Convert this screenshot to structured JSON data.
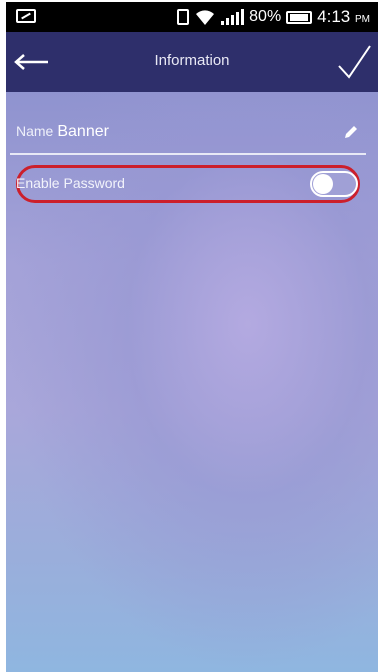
{
  "status_bar": {
    "battery_percent": "80%",
    "time": "4:13",
    "time_suffix": "PM"
  },
  "app_bar": {
    "title": "Information",
    "back_icon": "arrow-left-icon",
    "confirm_icon": "checkmark-icon"
  },
  "form": {
    "name_label": "Name",
    "name_value": "Banner",
    "edit_icon": "pencil-icon",
    "password_label": "Enable Password",
    "password_enabled": false
  },
  "colors": {
    "app_bar": "#2e2f6b",
    "highlight": "#cc1f2b"
  }
}
